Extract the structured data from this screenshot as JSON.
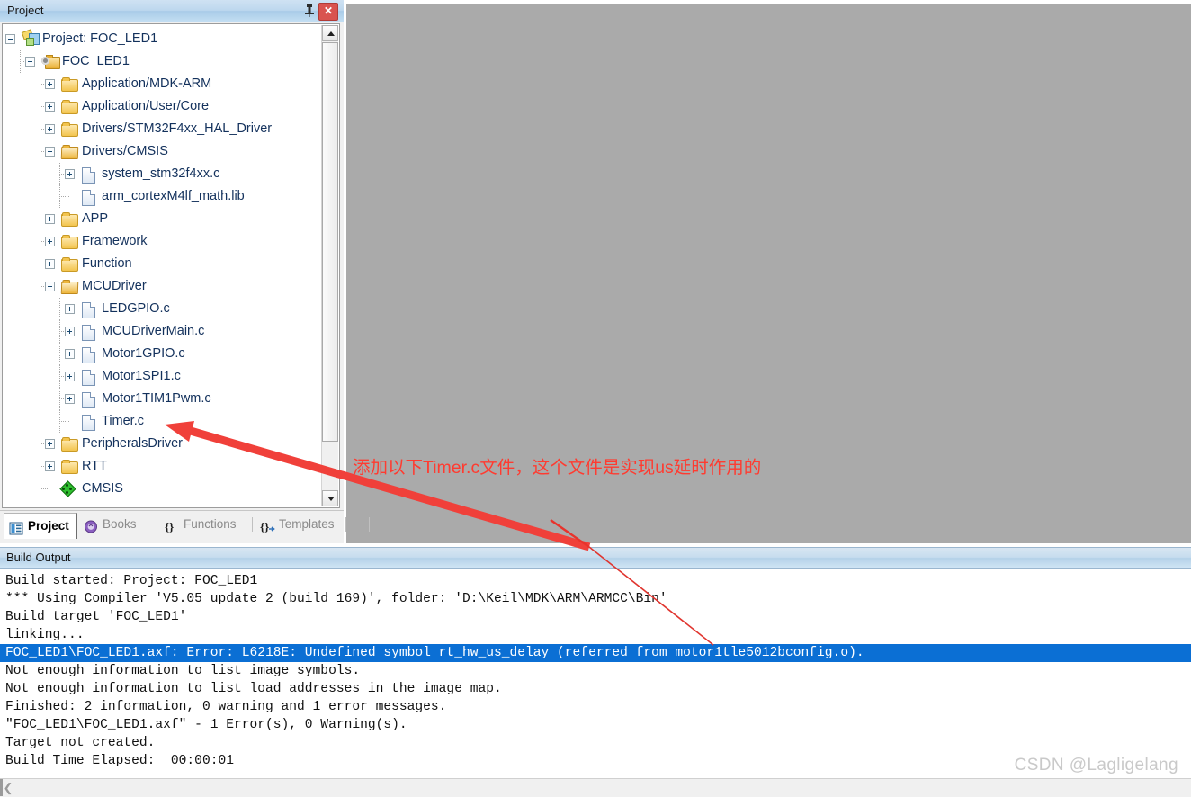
{
  "window": {
    "project_panel": {
      "title": "Project",
      "pin_icon": "pin-icon",
      "close_icon": "close-icon",
      "tree": [
        {
          "label": "Project: FOC_LED1",
          "depth": 0,
          "icon": "project-icon",
          "expander": "minus"
        },
        {
          "label": "FOC_LED1",
          "depth": 1,
          "icon": "target-gear-icon",
          "expander": "minus"
        },
        {
          "label": "Application/MDK-ARM",
          "depth": 2,
          "icon": "folder-icon",
          "expander": "plus"
        },
        {
          "label": "Application/User/Core",
          "depth": 2,
          "icon": "folder-icon",
          "expander": "plus"
        },
        {
          "label": "Drivers/STM32F4xx_HAL_Driver",
          "depth": 2,
          "icon": "folder-icon",
          "expander": "plus"
        },
        {
          "label": "Drivers/CMSIS",
          "depth": 2,
          "icon": "folder-open-icon",
          "expander": "minus"
        },
        {
          "label": "system_stm32f4xx.c",
          "depth": 3,
          "icon": "file-icon",
          "expander": "plus"
        },
        {
          "label": "arm_cortexM4lf_math.lib",
          "depth": 3,
          "icon": "file-icon",
          "expander": "none"
        },
        {
          "label": "APP",
          "depth": 2,
          "icon": "folder-icon",
          "expander": "plus"
        },
        {
          "label": "Framework",
          "depth": 2,
          "icon": "folder-icon",
          "expander": "plus"
        },
        {
          "label": "Function",
          "depth": 2,
          "icon": "folder-icon",
          "expander": "plus"
        },
        {
          "label": "MCUDriver",
          "depth": 2,
          "icon": "folder-open-icon",
          "expander": "minus"
        },
        {
          "label": "LEDGPIO.c",
          "depth": 3,
          "icon": "file-icon",
          "expander": "plus"
        },
        {
          "label": "MCUDriverMain.c",
          "depth": 3,
          "icon": "file-icon",
          "expander": "plus"
        },
        {
          "label": "Motor1GPIO.c",
          "depth": 3,
          "icon": "file-icon",
          "expander": "plus"
        },
        {
          "label": "Motor1SPI1.c",
          "depth": 3,
          "icon": "file-icon",
          "expander": "plus"
        },
        {
          "label": "Motor1TIM1Pwm.c",
          "depth": 3,
          "icon": "file-icon",
          "expander": "plus"
        },
        {
          "label": "Timer.c",
          "depth": 3,
          "icon": "file-icon",
          "expander": "none"
        },
        {
          "label": "PeripheralsDriver",
          "depth": 2,
          "icon": "folder-icon",
          "expander": "plus"
        },
        {
          "label": "RTT",
          "depth": 2,
          "icon": "folder-icon",
          "expander": "plus"
        },
        {
          "label": "CMSIS",
          "depth": 2,
          "icon": "green-diamond-icon",
          "expander": "none"
        }
      ],
      "tabs": [
        {
          "label": "Project",
          "icon": "project-tab-icon",
          "active": true
        },
        {
          "label": "Books",
          "icon": "books-icon",
          "active": false
        },
        {
          "label": "Functions",
          "icon": "braces-icon",
          "active": false
        },
        {
          "label": "Templates",
          "icon": "templates-icon",
          "active": false
        }
      ],
      "scrollbar": {
        "up_arrow": "scroll-up-icon",
        "down_arrow": "scroll-down-icon"
      }
    },
    "build_output": {
      "title": "Build Output",
      "lines": [
        {
          "text": "Build started: Project: FOC_LED1",
          "selected": false
        },
        {
          "text": "*** Using Compiler 'V5.05 update 2 (build 169)', folder: 'D:\\Keil\\MDK\\ARM\\ARMCC\\Bin'",
          "selected": false
        },
        {
          "text": "Build target 'FOC_LED1'",
          "selected": false
        },
        {
          "text": "linking...",
          "selected": false
        },
        {
          "text": "FOC_LED1\\FOC_LED1.axf: Error: L6218E: Undefined symbol rt_hw_us_delay (referred from motor1tle5012bconfig.o).",
          "selected": true
        },
        {
          "text": "Not enough information to list image symbols.",
          "selected": false
        },
        {
          "text": "Not enough information to list load addresses in the image map.",
          "selected": false
        },
        {
          "text": "Finished: 2 information, 0 warning and 1 error messages.",
          "selected": false
        },
        {
          "text": "\"FOC_LED1\\FOC_LED1.axf\" - 1 Error(s), 0 Warning(s).",
          "selected": false
        },
        {
          "text": "Target not created.",
          "selected": false
        },
        {
          "text": "Build Time Elapsed:  00:00:01",
          "selected": false
        }
      ],
      "hscroll_left_arrow": "scroll-left-icon"
    },
    "annotation": {
      "text": "添加以下Timer.c文件，这个文件是实现us延时作用的",
      "color": "#ff3b30",
      "arrow": "red-arrow"
    },
    "watermark": "CSDN @Lagligelang"
  },
  "colors": {
    "selection_blue": "#0b6fd4",
    "annotation_red": "#ff3b30",
    "panel_blue": "#bdd7ee",
    "editor_gray": "#aaaaaa",
    "tree_text": "#13315c"
  }
}
